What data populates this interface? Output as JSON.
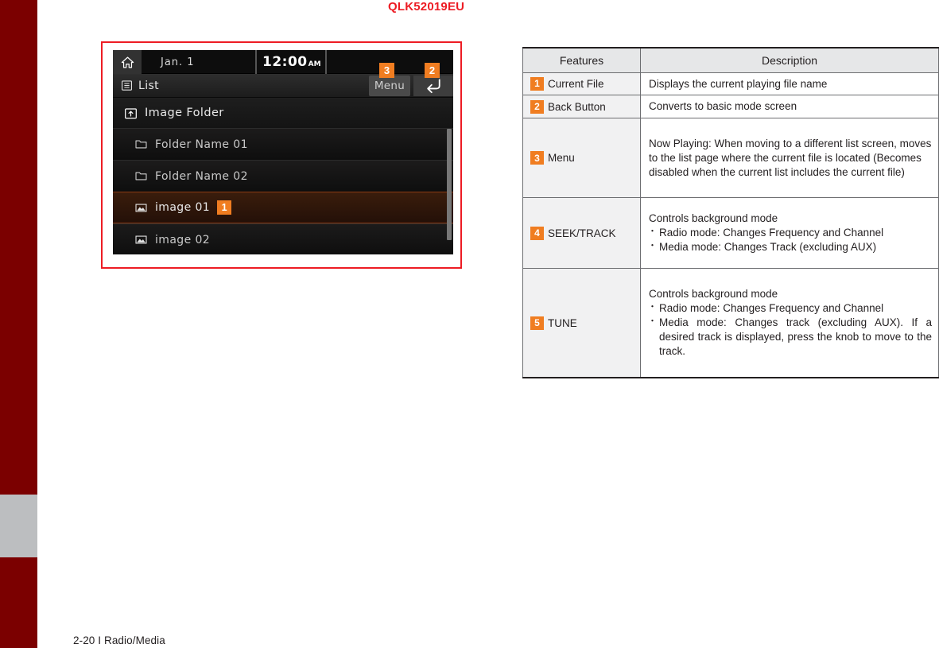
{
  "document": {
    "code": "QLK52019EU",
    "footer": "2-20 I Radio/Media"
  },
  "device_screen": {
    "status_bar": {
      "home_icon": "home-icon",
      "date": "Jan.  1",
      "time": "12:00",
      "meridiem": "AM"
    },
    "title_bar": {
      "list_icon": "list-icon",
      "title": "List",
      "menu_label": "Menu",
      "back_icon": "back-arrow-icon",
      "menu_callout": "3",
      "back_callout": "2"
    },
    "folder_header": {
      "icon": "folder-up-icon",
      "label": "Image Folder"
    },
    "list_items": [
      {
        "icon": "folder-icon",
        "label": "Folder Name 01",
        "selected": false,
        "badge": null
      },
      {
        "icon": "folder-icon",
        "label": "Folder Name 02",
        "selected": false,
        "badge": null
      },
      {
        "icon": "image-icon",
        "label": "image 01",
        "selected": true,
        "badge": "1"
      },
      {
        "icon": "image-icon",
        "label": "image 02",
        "selected": false,
        "badge": null
      }
    ]
  },
  "colors": {
    "accent_orange": "#f07d21",
    "frame_red": "#ed1c24",
    "spine_maroon": "#7b0000",
    "spine_tab_gray": "#bcbec0"
  },
  "table": {
    "headers": {
      "features": "Features",
      "description": "Description"
    },
    "rows": [
      {
        "badge": "1",
        "feature": "Current File",
        "lead": "Displays the current playing file name",
        "bullets": [],
        "justify": false
      },
      {
        "badge": "2",
        "feature": "Back Button",
        "lead": "Converts to basic mode screen",
        "bullets": [],
        "justify": false
      },
      {
        "badge": "3",
        "feature": "Menu",
        "lead": "Now Playing: When moving to a different list screen, moves to the list page where the current file is located (Becomes disabled when the current list includes the current file)",
        "bullets": [],
        "justify": false
      },
      {
        "badge": "4",
        "feature": "SEEK/TRACK",
        "lead": "Controls background mode",
        "bullets": [
          "Radio mode: Changes Frequency and Channel",
          "Media mode: Changes Track (excluding AUX)"
        ],
        "justify": false
      },
      {
        "badge": "5",
        "feature": "TUNE",
        "lead": "Controls background mode",
        "bullets": [
          "Radio mode: Changes Frequency and Channel",
          "Media mode: Changes track (excluding AUX). If a desired track is displayed, press the knob to move to the track."
        ],
        "justify": true
      }
    ]
  }
}
